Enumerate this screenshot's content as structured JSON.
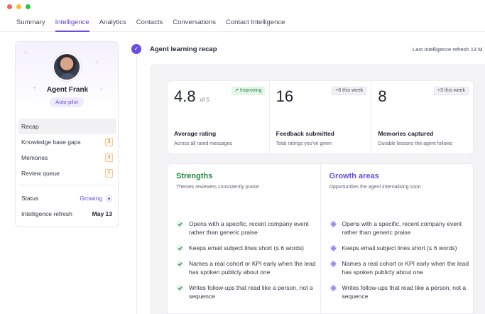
{
  "tabs": [
    "Summary",
    "Intelligence",
    "Analytics",
    "Contacts",
    "Conversations",
    "Contact Intelligence"
  ],
  "active_tab": "Intelligence",
  "profile": {
    "name": "Agent Frank",
    "badge": "Auto-pilot",
    "nav": [
      {
        "label": "Recap",
        "count": ""
      },
      {
        "label": "Knowledge base gaps",
        "count": "3"
      },
      {
        "label": "Memories",
        "count": "3"
      },
      {
        "label": "Review queue",
        "count": "7"
      }
    ],
    "status_label": "Status",
    "status_value": "Growing",
    "refresh_label": "Intelligence refresh",
    "refresh_value": "May 13"
  },
  "recap": {
    "title": "Agent learning recap",
    "last_refresh": "Last Intelligence refresh 13 M"
  },
  "stats": [
    {
      "value": "4.8",
      "suffix": "of 5",
      "pill": "Improving",
      "label": "Average rating",
      "sub": "Across all rated messages"
    },
    {
      "value": "16",
      "suffix": "",
      "pill": "+6 this week",
      "label": "Feedback submitted",
      "sub": "Total ratings you've given"
    },
    {
      "value": "8",
      "suffix": "",
      "pill": "+3 this week",
      "label": "Memories captured",
      "sub": "Durable lessons the agent follows"
    }
  ],
  "strengths": {
    "title": "Strengths",
    "sub": "Themes reviewers consistently praise",
    "items": [
      "Opens with a specific, recent company event rather than generic praise",
      "Keeps email subject lines short (≤ 6 words)",
      "Names a real cohort or KPI early when the lead has spoken publicly about one",
      "Writes follow-ups that read like a person, not a sequence"
    ]
  },
  "growth": {
    "title": "Growth areas",
    "sub": "Opportunities the agent internalising soon",
    "items": [
      "Opens with a specific, recent company event rather than generic praise",
      "Keeps email subject lines short (≤ 6 words)",
      "Names a real cohort or KPI early when the lead has spoken publicly about one",
      "Writes follow-ups that read like a person, not a sequence"
    ]
  },
  "colors": {
    "accent": "#6a4de0",
    "positive": "#23853f",
    "warning": "#c27a15"
  }
}
